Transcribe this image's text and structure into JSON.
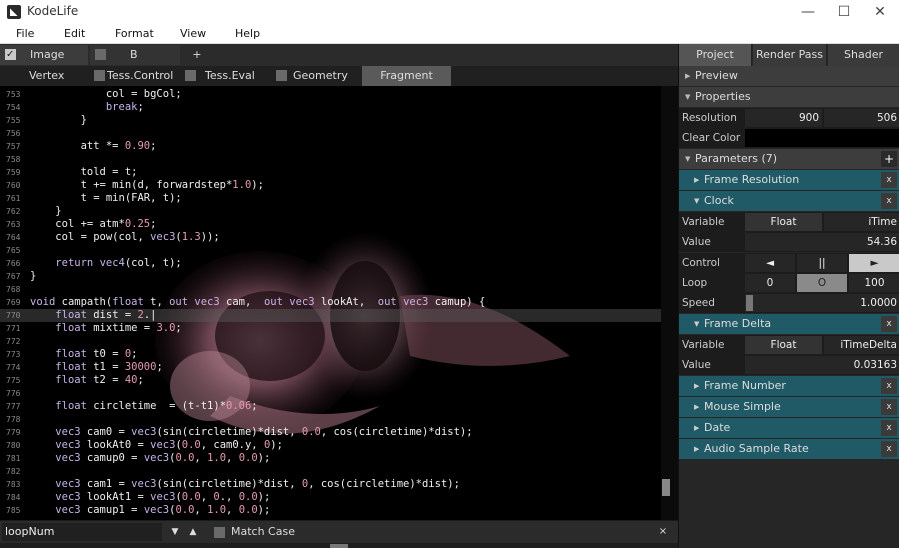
{
  "window": {
    "title": "KodeLife",
    "minimize": "—",
    "maximize": "☐",
    "close": "✕"
  },
  "menu": [
    "File",
    "Edit",
    "Format",
    "View",
    "Help"
  ],
  "tabs": {
    "image": "Image",
    "b": "B",
    "add": "+"
  },
  "stages": [
    "Vertex",
    "Tess.Control",
    "Tess.Eval",
    "Geometry",
    "Fragment"
  ],
  "code_lines": [
    {
      "n": "753",
      "t": "            col = bgCol;"
    },
    {
      "n": "754",
      "t": "            break;"
    },
    {
      "n": "755",
      "t": "        }"
    },
    {
      "n": "756",
      "t": ""
    },
    {
      "n": "757",
      "t": "        att *= 0.90;"
    },
    {
      "n": "758",
      "t": ""
    },
    {
      "n": "759",
      "t": "        told = t;"
    },
    {
      "n": "760",
      "t": "        t += min(d, forwardstep*1.0);"
    },
    {
      "n": "761",
      "t": "        t = min(FAR, t);"
    },
    {
      "n": "762",
      "t": "    }"
    },
    {
      "n": "763",
      "t": "    col += atm*0.25;"
    },
    {
      "n": "764",
      "t": "    col = pow(col, vec3(1.3));"
    },
    {
      "n": "765",
      "t": ""
    },
    {
      "n": "766",
      "t": "    return vec4(col, t);"
    },
    {
      "n": "767",
      "t": "}"
    },
    {
      "n": "768",
      "t": ""
    },
    {
      "n": "769",
      "t": "void campath(float t, out vec3 cam,  out vec3 lookAt,  out vec3 camup) {"
    },
    {
      "n": "770",
      "t": "    float dist = 2.|"
    },
    {
      "n": "771",
      "t": "    float mixtime = 3.0;"
    },
    {
      "n": "772",
      "t": ""
    },
    {
      "n": "773",
      "t": "    float t0 = 0;"
    },
    {
      "n": "774",
      "t": "    float t1 = 30000;"
    },
    {
      "n": "775",
      "t": "    float t2 = 40;"
    },
    {
      "n": "776",
      "t": ""
    },
    {
      "n": "777",
      "t": "    float circletime  = (t-t1)*0.06;"
    },
    {
      "n": "778",
      "t": ""
    },
    {
      "n": "779",
      "t": "    vec3 cam0 = vec3(sin(circletime)*dist, 0.0, cos(circletime)*dist);"
    },
    {
      "n": "780",
      "t": "    vec3 lookAt0 = vec3(0.0, cam0.y, 0);"
    },
    {
      "n": "781",
      "t": "    vec3 camup0 = vec3(0.0, 1.0, 0.0);"
    },
    {
      "n": "782",
      "t": ""
    },
    {
      "n": "783",
      "t": "    vec3 cam1 = vec3(sin(circletime)*dist, 0, cos(circletime)*dist);"
    },
    {
      "n": "784",
      "t": "    vec3 lookAt1 = vec3(0.0, 0., 0.0);"
    },
    {
      "n": "785",
      "t": "    vec3 camup1 = vec3(0.0, 1.0, 0.0);"
    }
  ],
  "find": {
    "value": "loopNum",
    "prev": "▼",
    "next": "▲",
    "match_case": "Match Case",
    "close": "×"
  },
  "panel": {
    "tabs": [
      "Project",
      "Render Pass",
      "Shader Stage"
    ],
    "preview": "Preview",
    "properties": "Properties",
    "resolution_label": "Resolution",
    "resolution_w": "900",
    "resolution_h": "506",
    "clear_color_label": "Clear Color",
    "parameters": "Parameters (7)",
    "add": "+",
    "frame_resolution": "Frame Resolution",
    "clock": "Clock",
    "clock_rows": {
      "variable_label": "Variable",
      "type": "Float",
      "name": "iTime",
      "value_label": "Value",
      "value": "54.36",
      "control_label": "Control",
      "rewind": "◄",
      "pause": "||",
      "play": "►",
      "loop_label": "Loop",
      "loop_start": "0",
      "loop_toggle": "O",
      "loop_end": "100",
      "speed_label": "Speed",
      "speed": "1.0000"
    },
    "frame_delta": "Frame Delta",
    "delta_rows": {
      "variable_label": "Variable",
      "type": "Float",
      "name": "iTimeDelta",
      "value_label": "Value",
      "value": "0.03163"
    },
    "frame_number": "Frame Number",
    "mouse_simple": "Mouse Simple",
    "date": "Date",
    "audio_sample_rate": "Audio Sample Rate",
    "x": "x"
  }
}
